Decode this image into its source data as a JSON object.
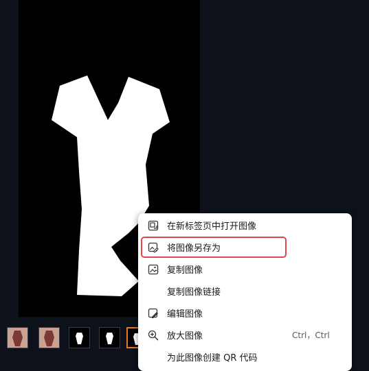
{
  "menu": {
    "items": [
      {
        "label": "在新标签页中打开图像",
        "icon": "open-new-tab-icon"
      },
      {
        "label": "将图像另存为",
        "icon": "save-image-icon"
      },
      {
        "label": "复制图像",
        "icon": "copy-image-icon"
      },
      {
        "label": "复制图像链接",
        "icon": ""
      },
      {
        "label": "编辑图像",
        "icon": "edit-image-icon"
      },
      {
        "label": "放大图像",
        "icon": "zoom-in-icon",
        "shortcut": "Ctrl，Ctrl"
      },
      {
        "label": "为此图像创建 QR 代码",
        "icon": ""
      }
    ],
    "highlighted_index": 1
  },
  "colors": {
    "page_background": "#0d111a",
    "image_background": "#000000",
    "selected_thumb_border": "#e87a24",
    "highlight_border": "#e0474c"
  }
}
